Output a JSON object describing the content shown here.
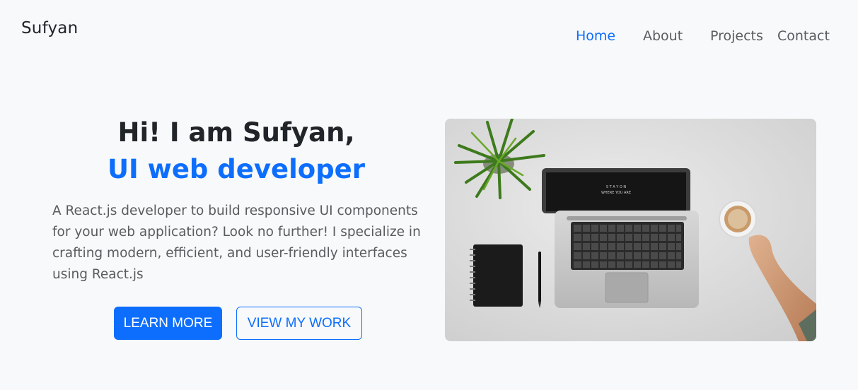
{
  "navbar": {
    "brand": "Sufyan",
    "links": [
      {
        "label": "Home",
        "active": true
      },
      {
        "label": "About",
        "active": false
      },
      {
        "label": "Projects",
        "active": false
      },
      {
        "label": "Contact",
        "active": false
      }
    ]
  },
  "hero": {
    "headline": "Hi! I am Sufyan,",
    "subheadline": "UI web developer",
    "description": "A React.js developer to build responsive UI components for your web application? Look no further! I specialize in crafting modern, efficient, and user-friendly interfaces using React.js",
    "primary_button": "LEARN MORE",
    "secondary_button": "VIEW MY WORK",
    "image": {
      "icon": "workspace-photo",
      "screen_text_line1": "S T A Y   O N",
      "screen_text_line2": "WHERE YOU ARE"
    }
  },
  "colors": {
    "accent": "#0d6efd",
    "text_dark": "#212529",
    "text_muted": "#595c5f",
    "background": "#f8f9fa"
  }
}
